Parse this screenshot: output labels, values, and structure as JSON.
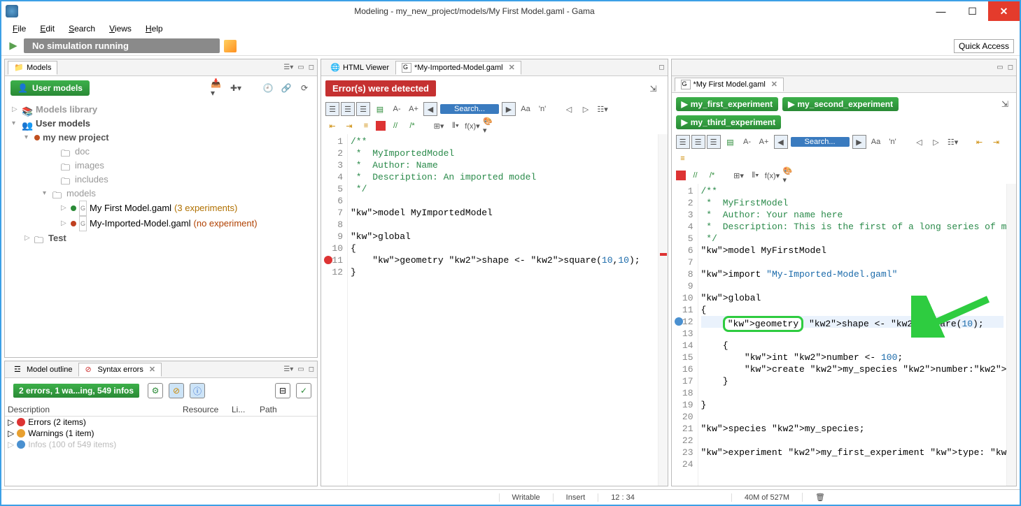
{
  "window": {
    "title": "Modeling - my_new_project/models/My First Model.gaml - Gama"
  },
  "menu": [
    "File",
    "Edit",
    "Search",
    "Views",
    "Help"
  ],
  "sim_status": "No simulation running",
  "quick_access": "Quick Access",
  "models_tab": "Models",
  "user_models_btn": "User models",
  "tree": {
    "models_library": "Models library",
    "user_models": "User models",
    "project": "my new project",
    "doc": "doc",
    "images": "images",
    "includes": "includes",
    "models": "models",
    "file1": "My First Model.gaml",
    "file1_annot": "(3 experiments)",
    "file2": "My-Imported-Model.gaml",
    "file2_annot": "(no experiment)",
    "test": "Test"
  },
  "outline": {
    "tab1": "Model outline",
    "tab2": "Syntax errors",
    "summary": "2 errors, 1 wa...ing, 549 infos",
    "col1": "Description",
    "col2": "Resource",
    "col3": "Li...",
    "col4": "Path",
    "row1": "Errors (2 items)",
    "row2": "Warnings (1 item)",
    "row3": "Infos (100 of 549 items)"
  },
  "mid_tabs": {
    "tab1": "HTML Viewer",
    "tab2": "*My-Imported-Model.gaml"
  },
  "error_banner": "Error(s) were detected",
  "search_placeholder": "Search...",
  "mid_code": {
    "lines": [
      {
        "n": 1,
        "t": "/**",
        "cls": "cm"
      },
      {
        "n": 2,
        "t": " *  MyImportedModel",
        "cls": "cm"
      },
      {
        "n": 3,
        "t": " *  Author: Name",
        "cls": "cm"
      },
      {
        "n": 4,
        "t": " *  Description: An imported model",
        "cls": "cm"
      },
      {
        "n": 5,
        "t": " */",
        "cls": "cm"
      },
      {
        "n": 6,
        "t": ""
      },
      {
        "n": 7,
        "t": "model MyImportedModel"
      },
      {
        "n": 8,
        "t": ""
      },
      {
        "n": 9,
        "t": "global"
      },
      {
        "n": 10,
        "t": "{"
      },
      {
        "n": 11,
        "t": "    geometry shape <- square(10,10);"
      },
      {
        "n": 12,
        "t": "}"
      }
    ]
  },
  "right_tab": "*My First Model.gaml",
  "experiments": [
    "my_first_experiment",
    "my_second_experiment",
    "my_third_experiment"
  ],
  "right_code": {
    "lines": [
      {
        "n": 1,
        "t": "/**",
        "cls": "cm"
      },
      {
        "n": 2,
        "t": " *  MyFirstModel",
        "cls": "cm"
      },
      {
        "n": 3,
        "t": " *  Author: Your name here",
        "cls": "cm"
      },
      {
        "n": 4,
        "t": " *  Description: This is the first of a long series of mo",
        "cls": "cm"
      },
      {
        "n": 5,
        "t": " */",
        "cls": "cm"
      },
      {
        "n": 6,
        "t": "model MyFirstModel"
      },
      {
        "n": 7,
        "t": ""
      },
      {
        "n": 8,
        "t": "import \"My-Imported-Model.gaml\""
      },
      {
        "n": 9,
        "t": ""
      },
      {
        "n": 10,
        "t": "global"
      },
      {
        "n": 11,
        "t": "{"
      },
      {
        "n": 12,
        "t": "    geometry shape <- square(10);",
        "hl": true
      },
      {
        "n": 13,
        "t": ""
      },
      {
        "n": 14,
        "t": "    {"
      },
      {
        "n": 15,
        "t": "        int number <- 100;"
      },
      {
        "n": 16,
        "t": "        create my_species number:number;"
      },
      {
        "n": 17,
        "t": "    }"
      },
      {
        "n": 18,
        "t": ""
      },
      {
        "n": 19,
        "t": "}"
      },
      {
        "n": 20,
        "t": ""
      },
      {
        "n": 21,
        "t": "species my_species;"
      },
      {
        "n": 22,
        "t": ""
      },
      {
        "n": 23,
        "t": "experiment my_first_experiment type: gui;"
      },
      {
        "n": 24,
        "t": ""
      }
    ]
  },
  "status": {
    "writable": "Writable",
    "insert": "Insert",
    "pos": "12 : 34",
    "heap": "40M of 527M"
  }
}
